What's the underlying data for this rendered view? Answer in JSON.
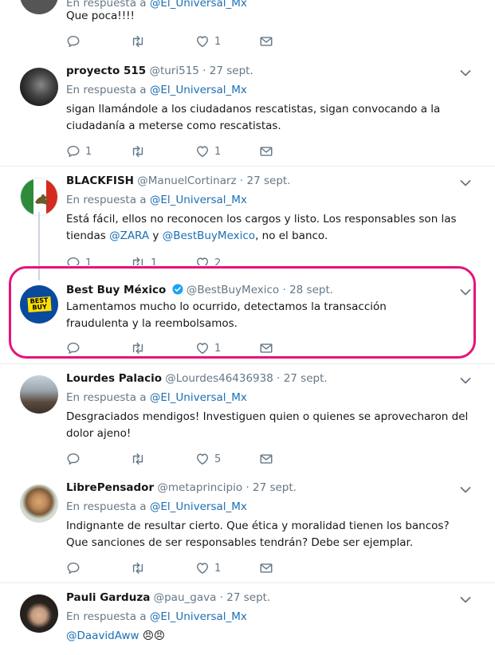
{
  "tweets": [
    {
      "text": "Que poca!!!!",
      "reply_prefix": "En respuesta a",
      "reply_to": "@El_Universal_Mx",
      "likes": "1"
    },
    {
      "name": "proyecto 515",
      "handle": "@turi515",
      "date": "· 27 sept.",
      "reply_prefix": "En respuesta a",
      "reply_to": "@El_Universal_Mx",
      "text": "sigan llamándole a los ciudadanos rescatistas, sigan convocando a la ciudadanía a meterse como rescatistas.",
      "replies": "1",
      "likes": "1"
    },
    {
      "name": "BLACKFISH",
      "handle": "@ManuelCortinarz",
      "date": "· 27 sept.",
      "reply_prefix": "En respuesta a",
      "reply_to": "@El_Universal_Mx",
      "text_a": "Está fácil, ellos no reconocen los cargos y listo. Los responsables son las tiendas ",
      "mention1": "@ZARA",
      "text_b": " y ",
      "mention2": "@BestBuyMexico",
      "text_c": ", no el banco.",
      "replies": "1",
      "retweets": "1",
      "likes": "2"
    },
    {
      "name": "Best Buy México",
      "handle": "@BestBuyMexico",
      "date": "· 28 sept.",
      "text": "Lamentamos mucho lo ocurrido, detectamos la transacción fraudulenta y la reembolsamos.",
      "likes": "1",
      "logo_line1": "BEST",
      "logo_line2": "BUY"
    },
    {
      "name": "Lourdes Palacio",
      "handle": "@Lourdes46436938",
      "date": "· 27 sept.",
      "reply_prefix": "En respuesta a",
      "reply_to": "@El_Universal_Mx",
      "text": "Desgraciados mendigos! Investiguen quien o quienes se aprovecharon del dolor ajeno!",
      "likes": "5"
    },
    {
      "name": "LibrePensador",
      "handle": "@metaprincipio",
      "date": "· 27 sept.",
      "reply_prefix": "En respuesta a",
      "reply_to": "@El_Universal_Mx",
      "text": "Indignante de resultar cierto. Que ética y moralidad tienen los bancos? Que sanciones de ser responsables tendrán? Debe ser ejemplar.",
      "likes": "1"
    },
    {
      "name": "Pauli Garduza",
      "handle": "@pau_gava",
      "date": "· 27 sept.",
      "reply_prefix": "En respuesta a",
      "reply_to": "@El_Universal_Mx",
      "text": "@DaavidAww",
      "emoji": "😠😠"
    }
  ],
  "colors": {
    "highlight": "#e6137a",
    "link": "#1b6fb3",
    "verified": "#1da1f2",
    "bestbuy_blue": "#0a4a9e",
    "bestbuy_yellow": "#ffe000"
  },
  "icons": [
    "reply-icon",
    "retweet-icon",
    "like-icon",
    "dm-icon",
    "chevron-down-icon",
    "verified-icon"
  ]
}
